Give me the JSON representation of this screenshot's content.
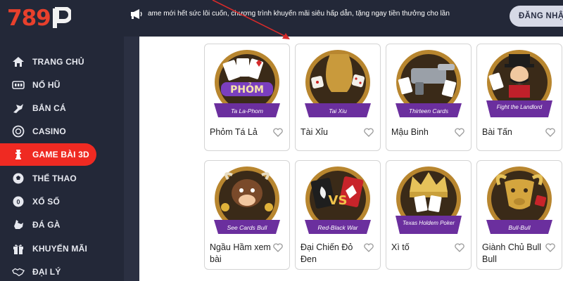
{
  "brand": {
    "logo_text": "789",
    "accent": "#ef2a22"
  },
  "topbar": {
    "marquee_icon": "megaphone-icon",
    "marquee_text": "ame mới hết sức lôi cuốn, chương trình khuyến mãi siêu hấp dẫn, tặng ngay tiền thưởng cho lần",
    "register_label": "ĐĂNG NHẬ"
  },
  "sidebar": {
    "items": [
      {
        "label": "TRANG CHỦ",
        "icon": "home-icon",
        "active": false
      },
      {
        "label": "NỔ HŨ",
        "icon": "slot-icon",
        "active": false
      },
      {
        "label": "BẮN CÁ",
        "icon": "fish-icon",
        "active": false
      },
      {
        "label": "CASINO",
        "icon": "casino-chip-icon",
        "active": false
      },
      {
        "label": "GAME BÀI 3D",
        "icon": "chess-icon",
        "active": true
      },
      {
        "label": "THỂ THAO",
        "icon": "soccer-icon",
        "active": false
      },
      {
        "label": "XỔ SỐ",
        "icon": "lottery-icon",
        "active": false
      },
      {
        "label": "ĐÁ GÀ",
        "icon": "rooster-icon",
        "active": false
      },
      {
        "label": "KHUYẾN MÃI",
        "icon": "gift-icon",
        "active": false
      },
      {
        "label": "ĐẠI LÝ",
        "icon": "handshake-icon",
        "active": false
      }
    ]
  },
  "games": [
    {
      "name": "Phỏm Tá Lả",
      "banner": "Ta La-Phom",
      "emblem": "PHỎM"
    },
    {
      "name": "Tài Xỉu",
      "banner": "Tai Xiu",
      "emblem": ""
    },
    {
      "name": "Mậu Binh",
      "banner": "Thirteen Cards",
      "emblem": ""
    },
    {
      "name": "Bài Tấn",
      "banner": "Fight the Landlord",
      "emblem": ""
    },
    {
      "name": "Ngầu Hầm xem bài",
      "banner": "See Cards Bull",
      "emblem": ""
    },
    {
      "name": "Đại Chiến Đỏ Đen",
      "banner": "Red-Black War",
      "emblem": "VS"
    },
    {
      "name": "Xì tố",
      "banner": "Texas Holdem Poker",
      "emblem": ""
    },
    {
      "name": "Giành Chủ Bull Bull",
      "banner": "Bull-Bull",
      "emblem": ""
    }
  ]
}
